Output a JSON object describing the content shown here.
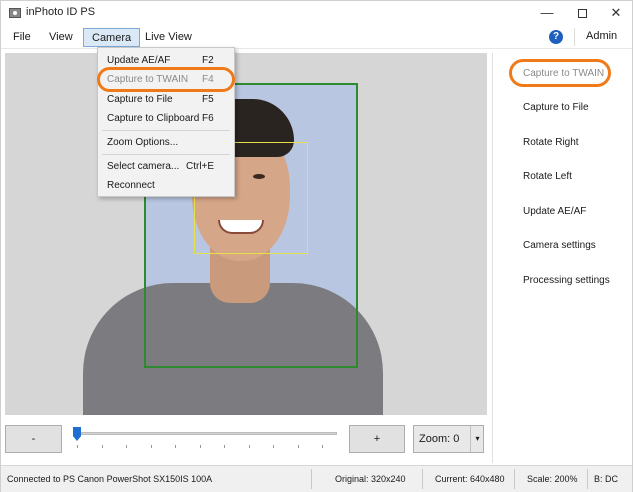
{
  "window": {
    "title": "inPhoto ID PS"
  },
  "menubar": {
    "items": [
      "File",
      "View",
      "Camera",
      "Live View"
    ],
    "admin": "Admin",
    "help_icon": "?"
  },
  "camera_menu": {
    "items": [
      {
        "label": "Update AE/AF",
        "shortcut": "F2",
        "enabled": true
      },
      {
        "label": "Capture to TWAIN",
        "shortcut": "F4",
        "enabled": false
      },
      {
        "label": "Capture to File",
        "shortcut": "F5",
        "enabled": true
      },
      {
        "label": "Capture to Clipboard",
        "shortcut": "F6",
        "enabled": true
      },
      {
        "label": "Zoom Options...",
        "shortcut": "",
        "enabled": true
      },
      {
        "label": "Select camera...",
        "shortcut": "Ctrl+E",
        "enabled": true
      },
      {
        "label": "Reconnect",
        "shortcut": "",
        "enabled": true
      }
    ]
  },
  "right_panel": {
    "items": [
      "Capture to TWAIN",
      "Capture to File",
      "Rotate Right",
      "Rotate Left",
      "Update AE/AF",
      "Camera settings",
      "Processing settings"
    ]
  },
  "controls": {
    "minus": "-",
    "plus": "+",
    "zoom": "Zoom: 0",
    "zoom_arrow": "▾"
  },
  "status": {
    "connection": "Connected to PS Canon PowerShot SX150IS 100A",
    "original": "Original: 320x240",
    "current": "Current: 640x480",
    "scale": "Scale: 200%",
    "b": "B: DC"
  },
  "colors": {
    "highlight_ring": "#f07a1a",
    "head_frame": "#2e8a2e",
    "face_frame": "#e6e04a",
    "slider_thumb": "#1f6fd1"
  },
  "icons": {
    "app": "camera-app-icon",
    "minimize": "minimize-icon",
    "maximize": "maximize-icon",
    "close": "close-icon",
    "help": "help-icon"
  }
}
